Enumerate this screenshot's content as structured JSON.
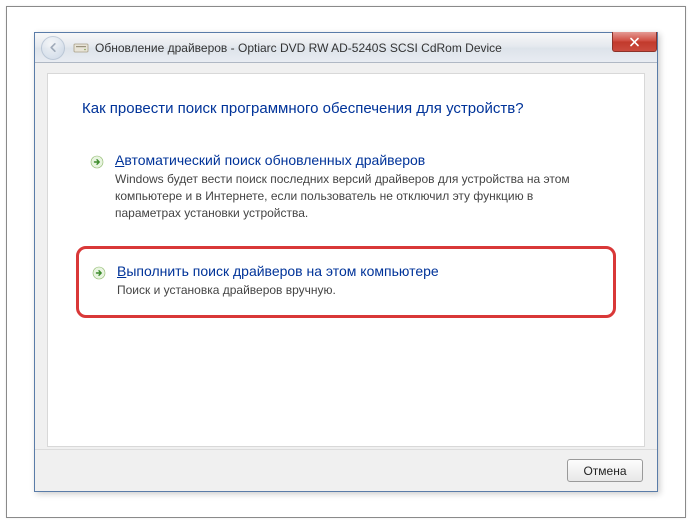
{
  "window": {
    "titlePrefix": "Обновление драйверов - ",
    "deviceName": "Optiarc DVD RW AD-5240S SCSI CdRom Device"
  },
  "heading": "Как провести поиск программного обеспечения для устройств?",
  "options": {
    "auto": {
      "titlePrefix": "А",
      "titleRest": "втоматический поиск обновленных драйверов",
      "description": "Windows будет вести поиск последних версий драйверов для устройства на этом компьютере и в Интернете, если пользователь не отключил эту функцию в параметрах установки устройства."
    },
    "manual": {
      "titlePrefix": "В",
      "titleRest": "ыполнить поиск драйверов на этом компьютере",
      "description": "Поиск и установка драйверов вручную."
    }
  },
  "buttons": {
    "cancel": "Отмена"
  }
}
